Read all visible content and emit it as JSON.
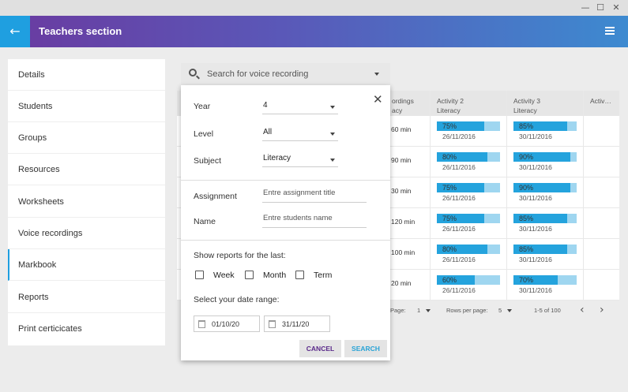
{
  "window": {
    "minimize": "—",
    "maximize": "☐",
    "close": "✕"
  },
  "appbar": {
    "back_icon": "←",
    "title": "Teachers section"
  },
  "sidebar": {
    "items": [
      {
        "label": "Details"
      },
      {
        "label": "Students"
      },
      {
        "label": "Groups"
      },
      {
        "label": "Resources"
      },
      {
        "label": "Worksheets"
      },
      {
        "label": "Voice recordings"
      },
      {
        "label": "Markbook"
      },
      {
        "label": "Reports"
      },
      {
        "label": "Print certicicates"
      }
    ],
    "active": "Markbook"
  },
  "search": {
    "placeholder": "Search for voice recording"
  },
  "table": {
    "header": {
      "recordings_line1": "ordings",
      "recordings_line2": "acy",
      "col2_line1": "Activity 2",
      "col2_line2": "Literacy",
      "col3_line1": "Activity 3",
      "col3_line2": "Literacy",
      "col4_line1": "Activ…"
    },
    "rows": [
      {
        "duration": "60 min",
        "a2": {
          "percent": "75%",
          "value": 0.75,
          "date": "26/11/2016"
        },
        "a3": {
          "percent": "85%",
          "value": 0.85,
          "date": "30/11/2016"
        }
      },
      {
        "duration": "90 min",
        "a2": {
          "percent": "80%",
          "value": 0.8,
          "date": "26/11/2016"
        },
        "a3": {
          "percent": "90%",
          "value": 0.9,
          "date": "30/11/2016"
        }
      },
      {
        "duration": "30 min",
        "a2": {
          "percent": "75%",
          "value": 0.75,
          "date": "26/11/2016"
        },
        "a3": {
          "percent": "90%",
          "value": 0.9,
          "date": "30/11/2016"
        }
      },
      {
        "duration": "120 min",
        "a2": {
          "percent": "75%",
          "value": 0.75,
          "date": "26/11/2016"
        },
        "a3": {
          "percent": "85%",
          "value": 0.85,
          "date": "30/11/2016"
        }
      },
      {
        "duration": "100 min",
        "a2": {
          "percent": "80%",
          "value": 0.8,
          "date": "26/11/2016"
        },
        "a3": {
          "percent": "85%",
          "value": 0.85,
          "date": "30/11/2016"
        }
      },
      {
        "duration": "20 min",
        "a2": {
          "percent": "60%",
          "value": 0.6,
          "date": "26/11/2016"
        },
        "a3": {
          "percent": "70%",
          "value": 0.7,
          "date": "30/11/2016"
        }
      }
    ],
    "footer": {
      "page_label": "Page:",
      "page_value": "1",
      "rows_label": "Rows per page:",
      "rows_value": "5",
      "range": "1-5 of 100",
      "prev_icon": "‹",
      "next_icon": "›"
    }
  },
  "popup": {
    "close_icon": "✕",
    "year_label": "Year",
    "year_value": "4",
    "level_label": "Level",
    "level_value": "All",
    "subject_label": "Subject",
    "subject_value": "Literacy",
    "assignment_label": "Assignment",
    "assignment_placeholder": "Entre assignment title",
    "name_label": "Name",
    "name_placeholder": "Entre students name",
    "reports_label": "Show reports for the last:",
    "week_label": "Week",
    "month_label": "Month",
    "term_label": "Term",
    "range_label": "Select your date range:",
    "date_from": "01/10/20",
    "date_to": "31/11/20",
    "cancel_label": "CANCEL",
    "search_label": "SEARCH"
  },
  "colors": {
    "accent": "#1f9fe0",
    "bar_fill": "#24a3dd",
    "bar_track": "#9fd6f0",
    "cancel": "#5a2a8a",
    "search": "#29a3d6"
  }
}
